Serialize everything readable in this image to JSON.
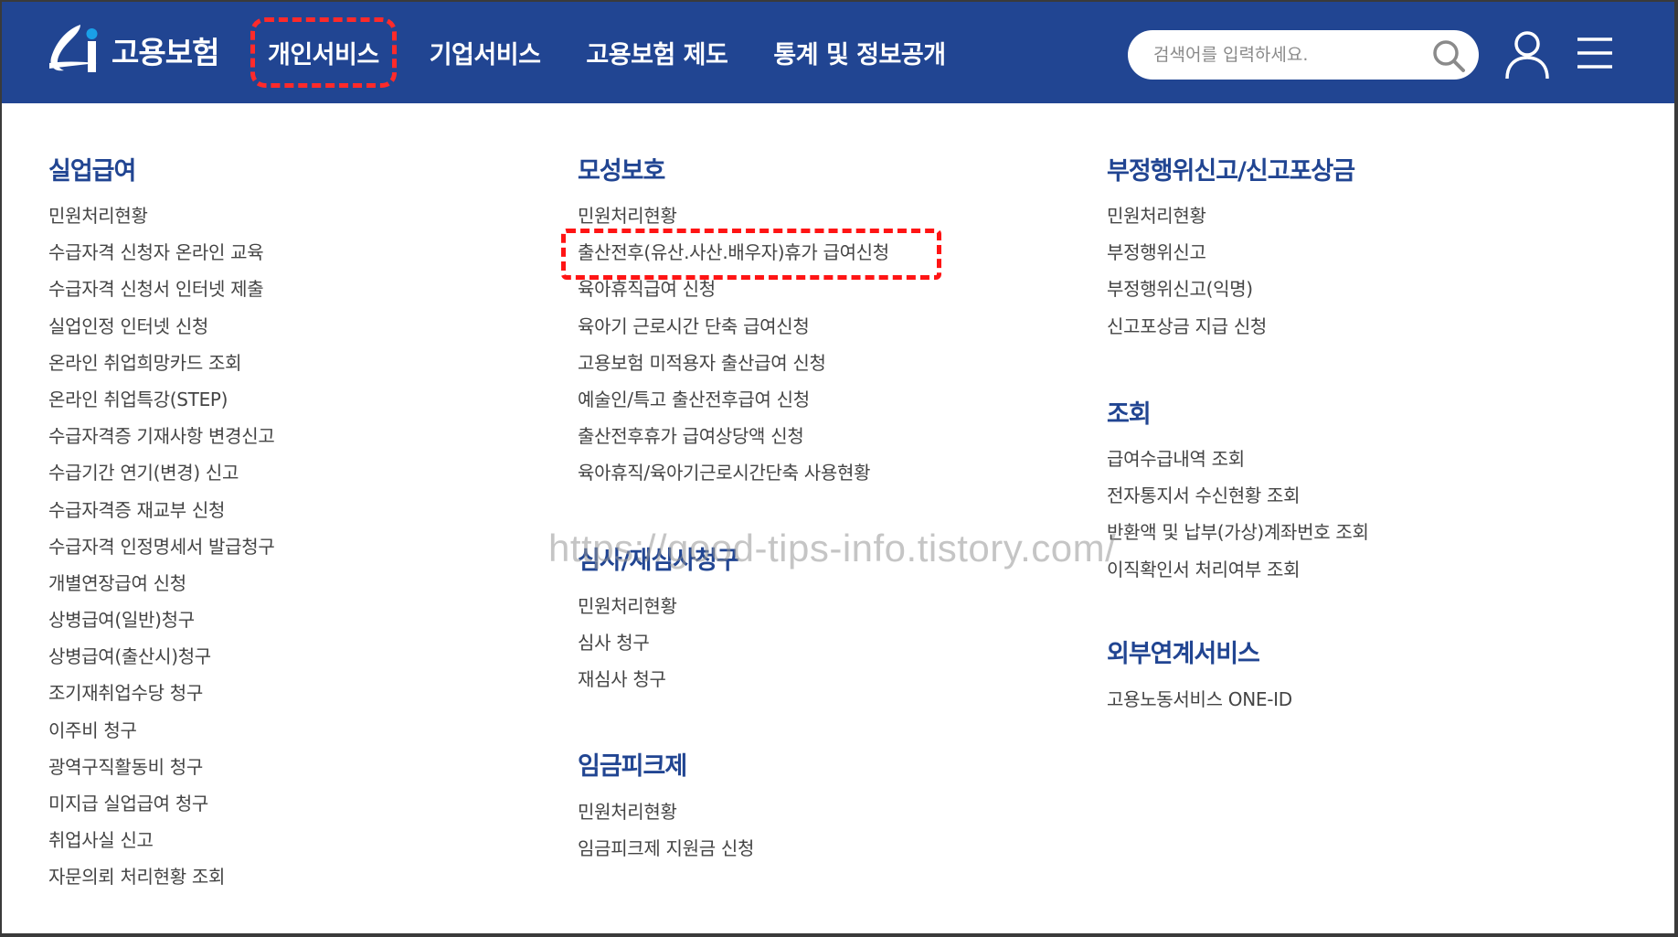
{
  "header": {
    "logo_text": "고용보험",
    "nav": [
      "개인서비스",
      "기업서비스",
      "고용보험 제도",
      "통계 및 정보공개"
    ],
    "search_placeholder": "검색어를 입력하세요."
  },
  "columns": [
    {
      "sections": [
        {
          "title": "실업급여",
          "items": [
            "민원처리현황",
            "수급자격 신청자 온라인 교육",
            "수급자격 신청서 인터넷 제출",
            "실업인정 인터넷 신청",
            "온라인 취업희망카드 조회",
            "온라인 취업특강(STEP)",
            "수급자격증 기재사항 변경신고",
            "수급기간 연기(변경) 신고",
            "수급자격증 재교부 신청",
            "수급자격 인정명세서 발급청구",
            "개별연장급여 신청",
            "상병급여(일반)청구",
            "상병급여(출산시)청구",
            "조기재취업수당 청구",
            "이주비 청구",
            "광역구직활동비 청구",
            "미지급 실업급여 청구",
            "취업사실 신고",
            "자문의뢰 처리현황 조회"
          ]
        }
      ]
    },
    {
      "sections": [
        {
          "title": "모성보호",
          "items": [
            "민원처리현황",
            "출산전후(유산.사산.배우자)휴가 급여신청",
            "육아휴직급여 신청",
            "육아기 근로시간 단축 급여신청",
            "고용보험 미적용자 출산급여 신청",
            "예술인/특고 출산전후급여 신청",
            "출산전후휴가 급여상당액 신청",
            "육아휴직/육아기근로시간단축 사용현황"
          ]
        },
        {
          "title": "심사/재심사청구",
          "items": [
            "민원처리현황",
            "심사 청구",
            "재심사 청구"
          ]
        },
        {
          "title": "임금피크제",
          "items": [
            "민원처리현황",
            "임금피크제 지원금 신청"
          ]
        }
      ]
    },
    {
      "sections": [
        {
          "title": "부정행위신고/신고포상금",
          "items": [
            "민원처리현황",
            "부정행위신고",
            "부정행위신고(익명)",
            "신고포상금 지급 신청"
          ]
        },
        {
          "title": "조회",
          "items": [
            "급여수급내역 조회",
            "전자통지서 수신현황 조회",
            "반환액 및 납부(가상)계좌번호 조회",
            "이직확인서 처리여부 조회"
          ]
        },
        {
          "title": "외부연계서비스",
          "items": [
            "고용노동서비스 ONE-ID"
          ]
        }
      ]
    }
  ],
  "watermark": "https://good-tips-info.tistory.com/",
  "colors": {
    "header_bg": "#214592",
    "section_title": "#214592",
    "highlight": "#ff1414"
  },
  "icons": [
    "logo-icon",
    "search-icon",
    "user-icon",
    "menu-icon"
  ]
}
